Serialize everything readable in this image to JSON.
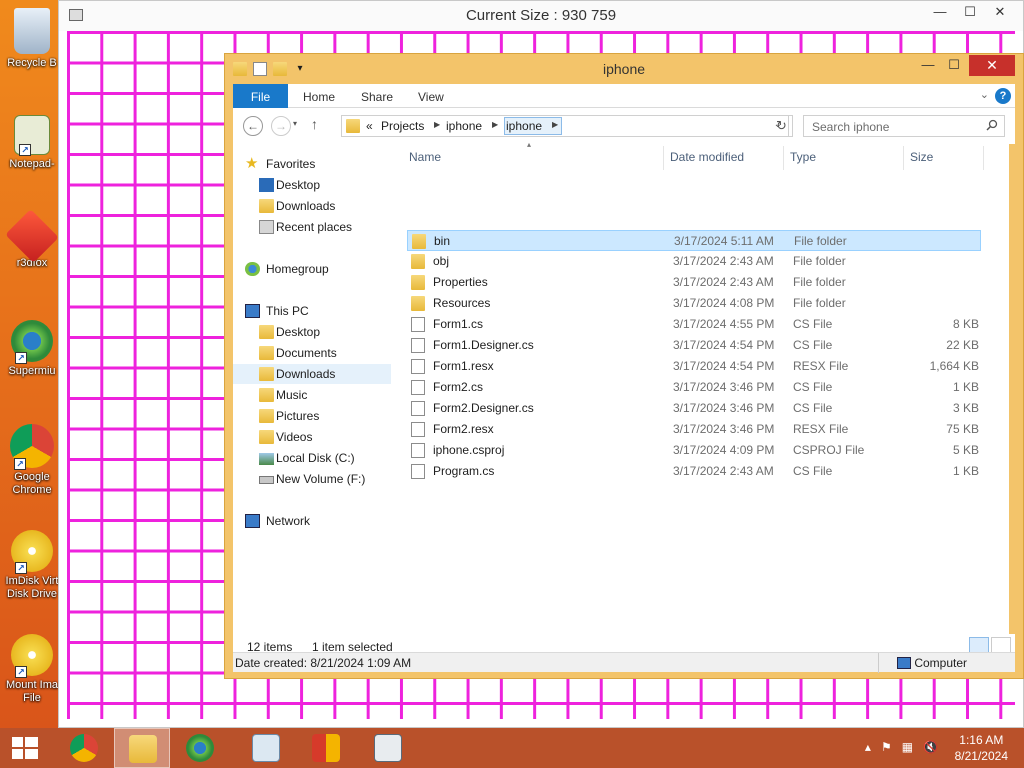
{
  "desktop": {
    "icons": [
      {
        "label": "Recycle B"
      },
      {
        "label": "Notepad-"
      },
      {
        "label": "r3dfox"
      },
      {
        "label": "Supermiu"
      },
      {
        "label": "Google Chrome"
      },
      {
        "label": "ImDisk Virt Disk Drive"
      },
      {
        "label": "Mount Ima File"
      }
    ]
  },
  "grid_window": {
    "title": "Current Size :  930 759"
  },
  "explorer": {
    "title": "iphone",
    "ribbon": {
      "file": "File",
      "home": "Home",
      "share": "Share",
      "view": "View"
    },
    "address": {
      "prefix": "«",
      "crumbs": [
        "Projects",
        "iphone",
        "iphone"
      ]
    },
    "search_placeholder": "Search iphone",
    "nav": {
      "favorites": "Favorites",
      "fav_items": [
        "Desktop",
        "Downloads",
        "Recent places"
      ],
      "homegroup": "Homegroup",
      "this_pc": "This PC",
      "pc_items": [
        "Desktop",
        "Documents",
        "Downloads",
        "Music",
        "Pictures",
        "Videos",
        "Local Disk (C:)",
        "New Volume (F:)"
      ],
      "network": "Network"
    },
    "columns": {
      "name": "Name",
      "date": "Date modified",
      "type": "Type",
      "size": "Size"
    },
    "files": [
      {
        "name": "bin",
        "date": "3/17/2024 5:11 AM",
        "type": "File folder",
        "size": "",
        "kind": "folder"
      },
      {
        "name": "obj",
        "date": "3/17/2024 2:43 AM",
        "type": "File folder",
        "size": "",
        "kind": "folder"
      },
      {
        "name": "Properties",
        "date": "3/17/2024 2:43 AM",
        "type": "File folder",
        "size": "",
        "kind": "folder"
      },
      {
        "name": "Resources",
        "date": "3/17/2024 4:08 PM",
        "type": "File folder",
        "size": "",
        "kind": "folder"
      },
      {
        "name": "Form1.cs",
        "date": "3/17/2024 4:55 PM",
        "type": "CS File",
        "size": "8 KB",
        "kind": "file"
      },
      {
        "name": "Form1.Designer.cs",
        "date": "3/17/2024 4:54 PM",
        "type": "CS File",
        "size": "22 KB",
        "kind": "file"
      },
      {
        "name": "Form1.resx",
        "date": "3/17/2024 4:54 PM",
        "type": "RESX File",
        "size": "1,664 KB",
        "kind": "file"
      },
      {
        "name": "Form2.cs",
        "date": "3/17/2024 3:46 PM",
        "type": "CS File",
        "size": "1 KB",
        "kind": "file"
      },
      {
        "name": "Form2.Designer.cs",
        "date": "3/17/2024 3:46 PM",
        "type": "CS File",
        "size": "3 KB",
        "kind": "file"
      },
      {
        "name": "Form2.resx",
        "date": "3/17/2024 3:46 PM",
        "type": "RESX File",
        "size": "75 KB",
        "kind": "file"
      },
      {
        "name": "iphone.csproj",
        "date": "3/17/2024 4:09 PM",
        "type": "CSPROJ File",
        "size": "5 KB",
        "kind": "file"
      },
      {
        "name": "Program.cs",
        "date": "3/17/2024 2:43 AM",
        "type": "CS File",
        "size": "1 KB",
        "kind": "file"
      }
    ],
    "status": {
      "count": "12 items",
      "selected": "1 item selected",
      "date_created": "Date created: 8/21/2024 1:09 AM",
      "computer": "Computer"
    }
  },
  "taskbar": {
    "time": "1:16 AM",
    "date": "8/21/2024"
  }
}
